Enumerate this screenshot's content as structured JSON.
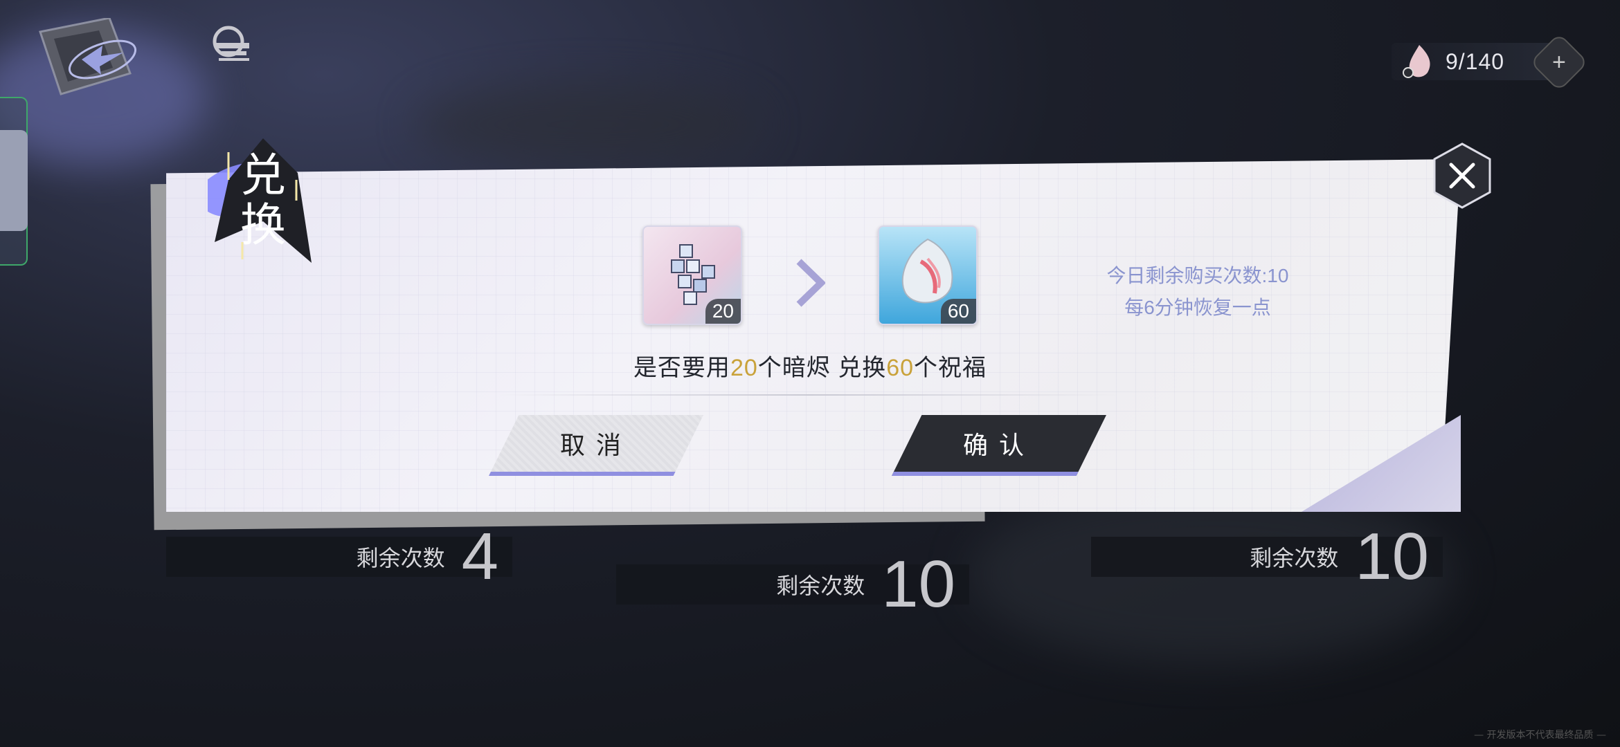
{
  "topbar": {
    "stamina_value": "9/140",
    "stamina_add": "+"
  },
  "background_cards": [
    {
      "label": "剩余次数",
      "count": "4"
    },
    {
      "label": "剩余次数",
      "count": "10"
    },
    {
      "label": "剩余次数",
      "count": "10"
    }
  ],
  "dialog": {
    "badge_title": "兑换",
    "cost_item": {
      "name": "暗烬",
      "count": "20"
    },
    "reward_item": {
      "name": "祝福",
      "count": "60"
    },
    "info_line1": "今日剩余购买次数:10",
    "info_line2": "每6分钟恢复一点",
    "question_pre": "是否要用",
    "question_cost": "20",
    "question_mid": "个暗烬 兑换",
    "question_reward": "60",
    "question_post": "个祝福",
    "cancel_label": "取消",
    "confirm_label": "确认"
  },
  "watermark": "— 开发版本不代表最终品质 —",
  "colors": {
    "highlight": "#c9a23a",
    "info_text": "#8a94cf",
    "accent_violet": "#8f8fe0",
    "confirm_bg": "#2a2c32"
  },
  "icons": [
    "back-icon",
    "logo-icon",
    "stamina-drop-icon",
    "plus-icon",
    "close-icon",
    "cube-cluster-icon",
    "feather-orb-icon",
    "chevron-right-icon"
  ]
}
